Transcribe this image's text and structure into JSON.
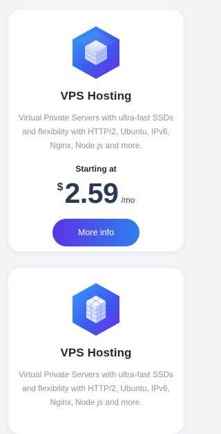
{
  "cards": [
    {
      "title": "VPS Hosting",
      "description": "Virtual Private Servers with ultra-fast SSDs and flexibility with HTTP/2, Ubuntu, IPv6, Nginx, Node.js and more.",
      "starting_label": "Starting at",
      "price": {
        "currency": "$",
        "amount": "2.59",
        "period": "/mo"
      },
      "button_label": "More info",
      "icon": "server-stack-hexagon-icon"
    },
    {
      "title": "VPS Hosting",
      "description": "Virtual Private Servers with ultra-fast SSDs and flexibility with HTTP/2, Ubuntu, IPv6, Nginx, Node.js and more.",
      "icon": "server-cluster-hexagon-icon"
    }
  ],
  "colors": {
    "accent_start": "#5b34e8",
    "accent_end": "#2f80ed",
    "title": "#1d2733",
    "body_text": "#8a93a0"
  }
}
